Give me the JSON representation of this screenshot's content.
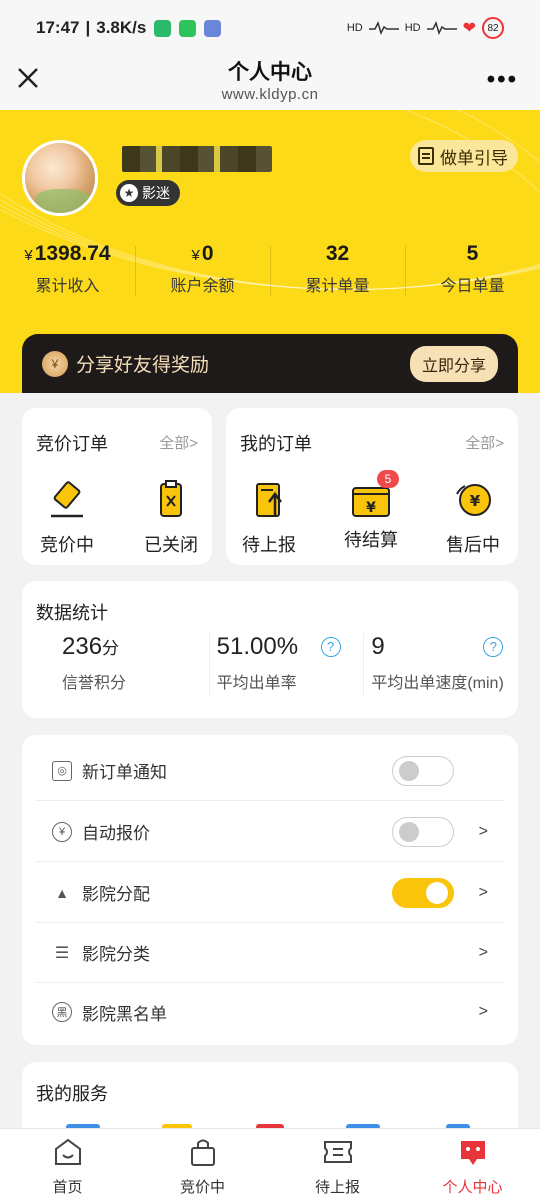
{
  "statusbar": {
    "time": "17:47",
    "speed": "3.8K/s",
    "network": "HD",
    "battery": "82"
  },
  "nav": {
    "title": "个人中心",
    "url": "www.kldyp.cn"
  },
  "profile": {
    "badge": "影迷",
    "guide_label": "做单引导"
  },
  "stats": [
    {
      "prefix": "¥",
      "value": "1398.74",
      "label": "累计收入"
    },
    {
      "prefix": "¥",
      "value": "0",
      "label": "账户余额"
    },
    {
      "prefix": "",
      "value": "32",
      "label": "累计单量"
    },
    {
      "prefix": "",
      "value": "5",
      "label": "今日单量"
    }
  ],
  "share": {
    "text": "分享好友得奖励",
    "button": "立即分享",
    "coin": "¥"
  },
  "bid_orders": {
    "title": "竞价订单",
    "more": "全部>",
    "items": [
      {
        "label": "竞价中",
        "icon": "gavel-icon"
      },
      {
        "label": "已关闭",
        "icon": "clipboard-closed-icon"
      }
    ]
  },
  "my_orders": {
    "title": "我的订单",
    "more": "全部>",
    "items": [
      {
        "label": "待上报",
        "icon": "upload-doc-icon",
        "badge": ""
      },
      {
        "label": "待结算",
        "icon": "wallet-yen-icon",
        "badge": "5"
      },
      {
        "label": "售后中",
        "icon": "refund-yen-icon",
        "badge": ""
      }
    ]
  },
  "data_stats": {
    "title": "数据统计",
    "items": [
      {
        "value": "236",
        "unit": "分",
        "label": "信誉积分",
        "help": false
      },
      {
        "value": "51.00%",
        "unit": "",
        "label": "平均出单率",
        "help": true
      },
      {
        "value": "9",
        "unit": "",
        "label": "平均出单速度(min)",
        "help": true
      }
    ],
    "help_symbol": "?"
  },
  "settings": [
    {
      "label": "新订单通知",
      "icon": "notification-icon",
      "toggle": false,
      "arrow": ""
    },
    {
      "label": "自动报价",
      "icon": "auto-price-icon",
      "toggle": false,
      "arrow": ">"
    },
    {
      "label": "影院分配",
      "icon": "hierarchy-icon",
      "toggle": true,
      "arrow": ">"
    },
    {
      "label": "影院分类",
      "icon": "list-icon",
      "toggle": null,
      "arrow": ">"
    },
    {
      "label": "影院黑名单",
      "icon": "blacklist-icon",
      "toggle": null,
      "arrow": ">",
      "icon_char": "黑"
    }
  ],
  "services": {
    "title": "我的服务"
  },
  "tabbar": [
    {
      "label": "首页",
      "icon": "home-icon",
      "active": false
    },
    {
      "label": "竞价中",
      "icon": "bag-icon",
      "active": false
    },
    {
      "label": "待上报",
      "icon": "ticket-icon",
      "active": false
    },
    {
      "label": "个人中心",
      "icon": "profile-chat-icon",
      "active": true
    }
  ],
  "colors": {
    "brand_yellow": "#fdda18",
    "accent_red": "#e8343b",
    "toggle_on": "#fac40a",
    "help_blue": "#3ba3e8"
  }
}
